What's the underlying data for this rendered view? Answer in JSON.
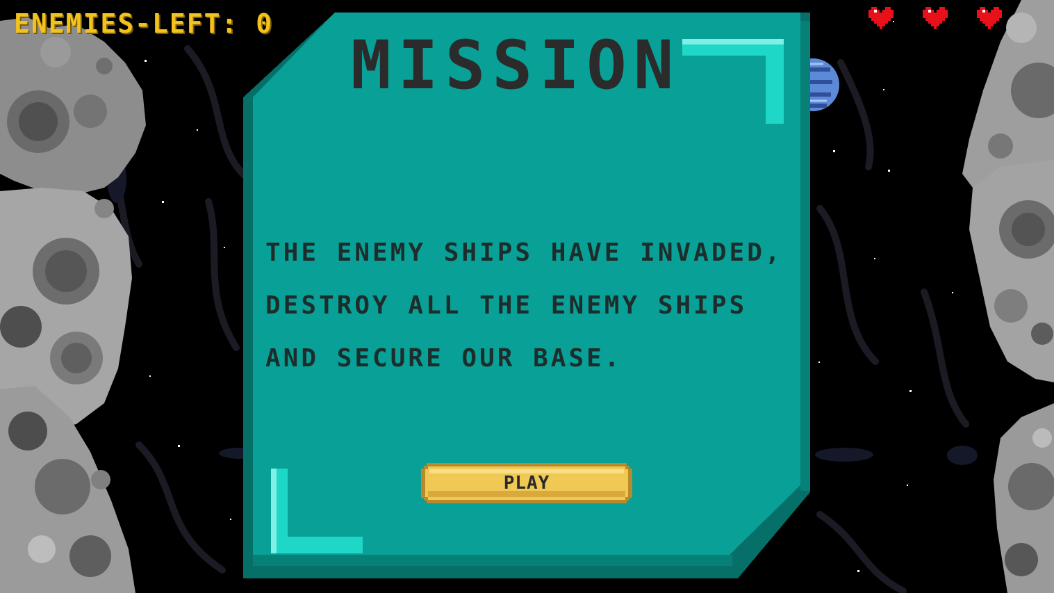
{
  "hud": {
    "enemies_left_label": "ENEMIES-LEFT: 0",
    "lives": [
      "heart-icon",
      "heart-icon",
      "heart-icon"
    ],
    "counter_color": "#f4c21c",
    "heart_color": "#e8111a"
  },
  "mission_panel": {
    "title": "MISSION",
    "lines": [
      "THE ENEMY SHIPS HAVE INVADED,",
      "DESTROY ALL THE ENEMY SHIPS",
      "AND SECURE OUR BASE."
    ],
    "play_label": "PLAY",
    "panel_color": "#09a197",
    "accent_color": "#1ed7c7",
    "button_color": "#f0c955"
  }
}
